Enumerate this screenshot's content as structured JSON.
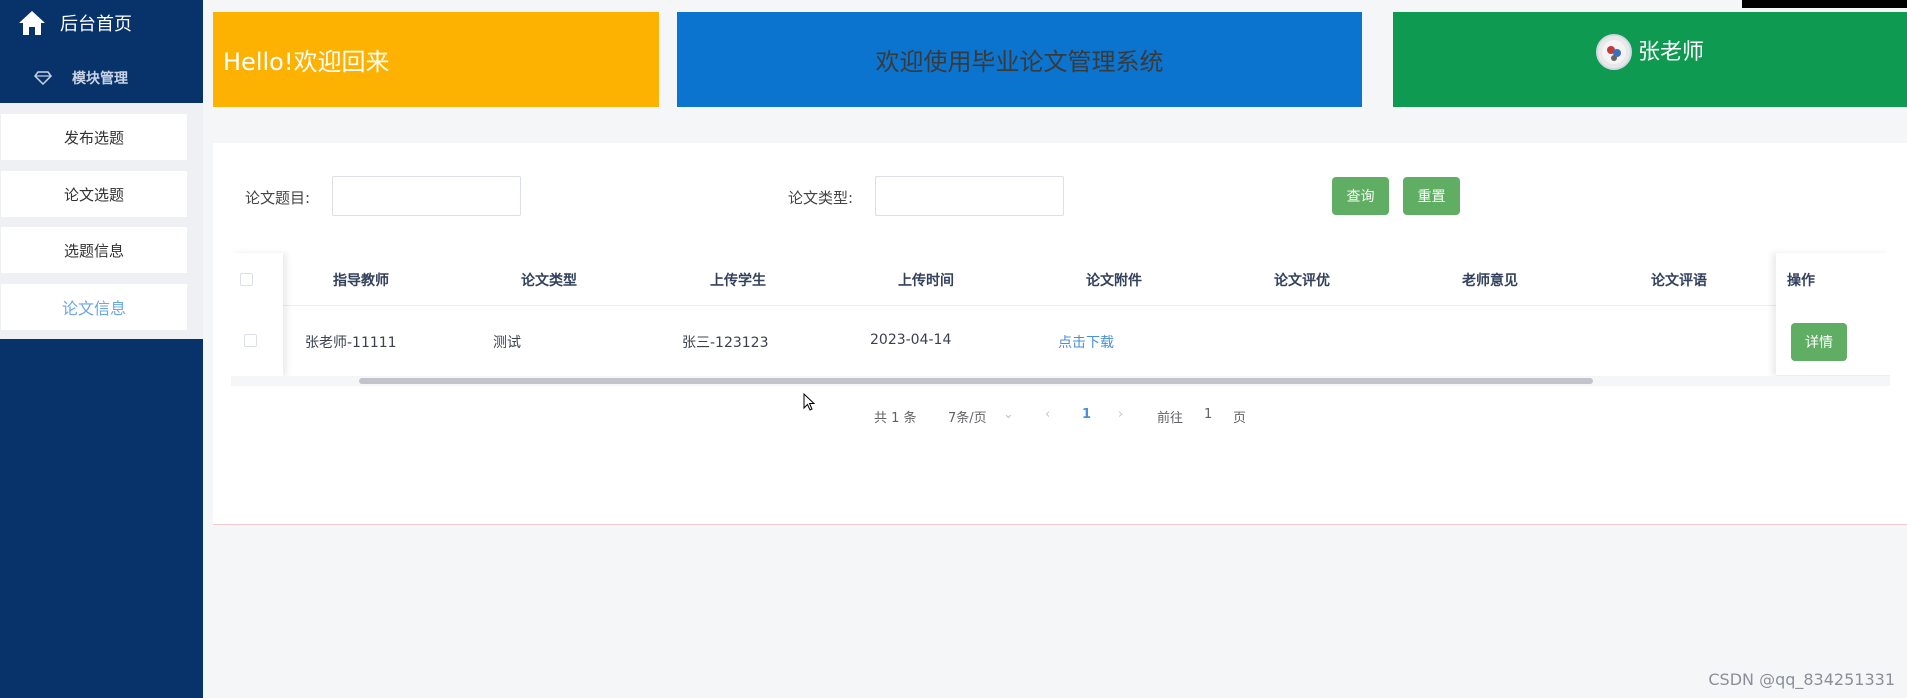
{
  "sidebar": {
    "home_label": "后台首页",
    "group_label": "模块管理",
    "items": [
      {
        "label": "发布选题"
      },
      {
        "label": "论文选题"
      },
      {
        "label": "选题信息"
      },
      {
        "label": "论文信息"
      }
    ]
  },
  "header": {
    "welcome": "Hello!欢迎回来",
    "system_title": "欢迎使用毕业论文管理系统",
    "user_name": "张老师"
  },
  "search": {
    "title_label": "论文题目:",
    "type_label": "论文类型:",
    "title_value": "",
    "type_value": "",
    "query_button": "查询",
    "reset_button": "重置"
  },
  "table": {
    "columns": [
      "指导教师",
      "论文类型",
      "上传学生",
      "上传时间",
      "论文附件",
      "论文评优",
      "老师意见",
      "论文评语"
    ],
    "action_column": "操作",
    "rows": [
      {
        "teacher": "张老师-11111",
        "type": "测试",
        "student": "张三-123123",
        "time": "2023-04-14",
        "attachment": "点击下载",
        "excellent": "",
        "opinion": "",
        "comment": "",
        "action": "详情"
      }
    ]
  },
  "pagination": {
    "total": "共 1 条",
    "page_size": "7条/页",
    "current_page": "1",
    "goto_prefix": "前往",
    "goto_value": "1",
    "goto_suffix": "页"
  },
  "watermark": "CSDN @qq_834251331",
  "colors": {
    "sidebar": "#07336a",
    "card_yellow": "#fdb100",
    "card_blue": "#0b74cf",
    "card_green": "#0e9a50",
    "button_green": "#5fae63",
    "link_blue": "#4a90d9"
  }
}
